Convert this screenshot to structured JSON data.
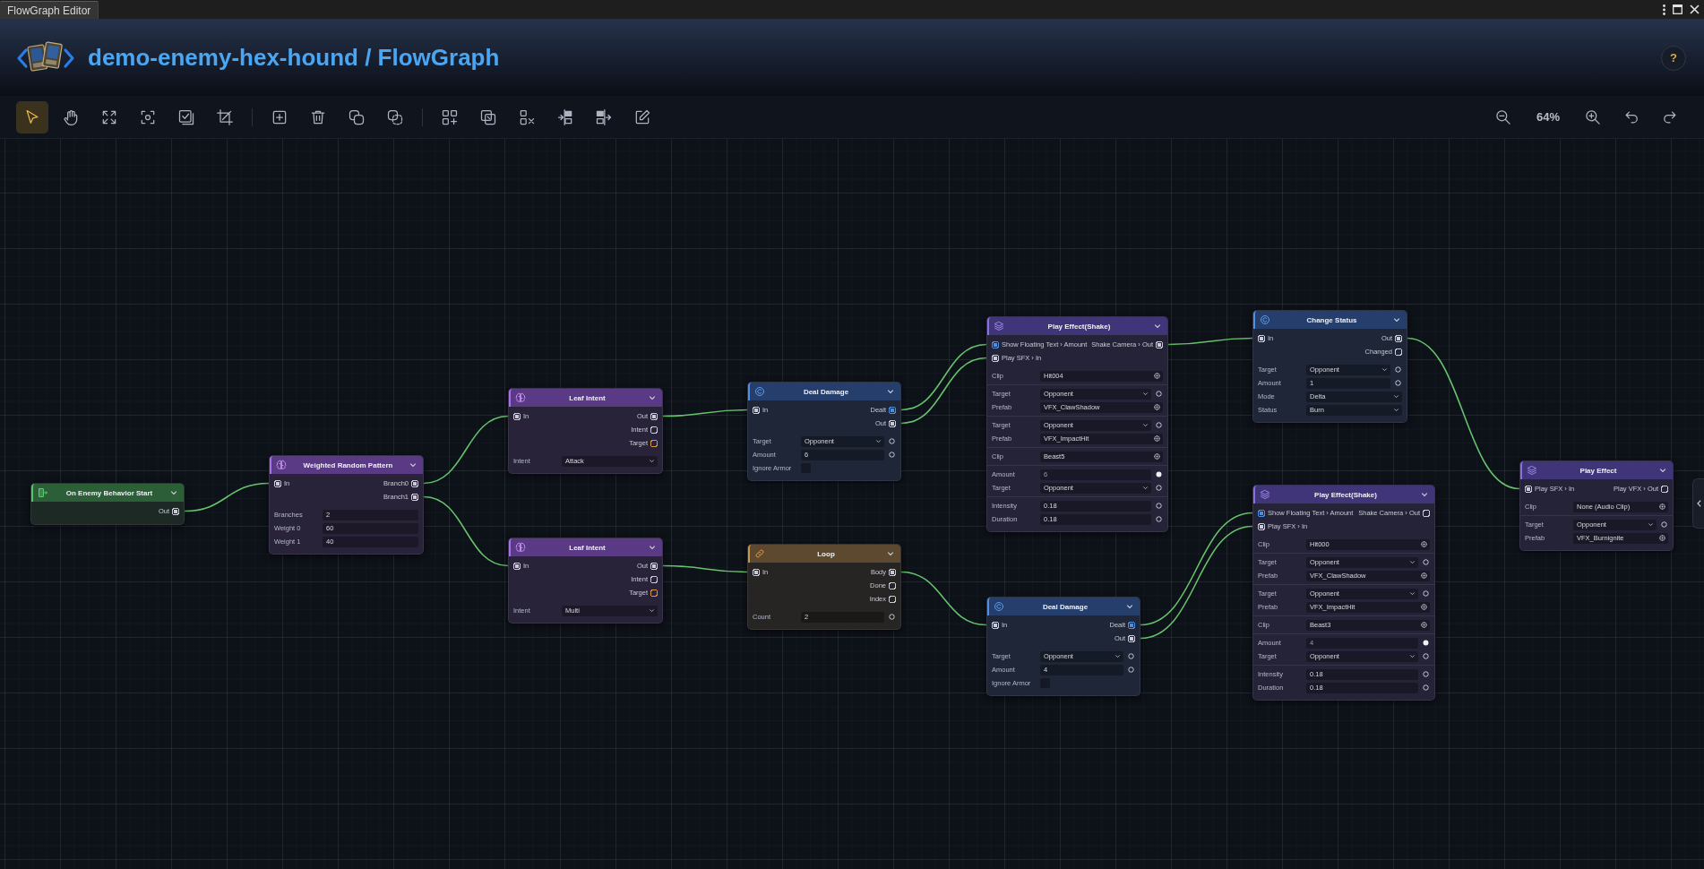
{
  "window": {
    "tab": "FlowGraph Editor"
  },
  "header": {
    "title": "demo-enemy-hex-hound / FlowGraph",
    "help": "?"
  },
  "toolbar": {
    "tool_groups": [
      [
        {
          "selected": true
        },
        {
          "selected": false
        },
        {
          "selected": false
        },
        {
          "selected": false
        },
        {
          "selected": false
        },
        {
          "selected": false
        }
      ],
      [
        {
          "selected": false
        },
        {
          "selected": false
        },
        {
          "selected": false
        },
        {
          "selected": false
        }
      ],
      [
        {
          "selected": false
        },
        {
          "selected": false
        },
        {
          "selected": false
        },
        {
          "selected": false
        },
        {
          "selected": false
        },
        {
          "selected": false
        }
      ]
    ],
    "zoom": "64%"
  },
  "nodes": [
    {
      "kind": "event",
      "title": "On Enemy Behavior Start",
      "outputs": [
        {
          "label": "Out",
          "connected": true,
          "color": "#c9ccd8"
        }
      ]
    },
    {
      "kind": "intent",
      "title": "Weighted Random Pattern",
      "inputs": [
        {
          "label": "In",
          "connected": true,
          "color": "#c9ccd8"
        }
      ],
      "outputs": [
        {
          "label": "Branch0",
          "connected": true,
          "color": "#c9ccd8"
        },
        {
          "label": "Branch1",
          "connected": true,
          "color": "#c9ccd8"
        }
      ],
      "sections": [
        {
          "fields": [
            {
              "label": "Branches",
              "value": "2",
              "kind": "text"
            },
            {
              "label": "Weight 0",
              "value": "60",
              "kind": "text"
            },
            {
              "label": "Weight 1",
              "value": "40",
              "kind": "text"
            }
          ]
        }
      ]
    },
    {
      "kind": "intent",
      "title": "Leaf Intent",
      "inputs": [
        {
          "label": "In",
          "connected": true,
          "color": "#c9ccd8"
        }
      ],
      "outputs": [
        {
          "label": "Out",
          "connected": true,
          "color": "#c9ccd8"
        },
        {
          "label": "Intent",
          "connected": false,
          "color": "#c9ccd8"
        },
        {
          "label": "Target",
          "connected": false,
          "color": "#e0923a"
        }
      ],
      "sections": [
        {
          "fields": [
            {
              "label": "Intent",
              "value": "Attack",
              "kind": "dropdown"
            }
          ]
        }
      ]
    },
    {
      "kind": "intent",
      "title": "Leaf Intent",
      "inputs": [
        {
          "label": "In",
          "connected": true,
          "color": "#c9ccd8"
        }
      ],
      "outputs": [
        {
          "label": "Out",
          "connected": true,
          "color": "#c9ccd8"
        },
        {
          "label": "Intent",
          "connected": false,
          "color": "#c9ccd8"
        },
        {
          "label": "Target",
          "connected": false,
          "color": "#e0923a"
        }
      ],
      "sections": [
        {
          "fields": [
            {
              "label": "Intent",
              "value": "Multi",
              "kind": "dropdown"
            }
          ]
        }
      ]
    },
    {
      "kind": "action",
      "title": "Deal Damage",
      "inputs": [
        {
          "label": "In",
          "connected": true,
          "color": "#c9ccd8"
        }
      ],
      "outputs": [
        {
          "label": "Dealt",
          "connected": true,
          "color": "#4a90e2"
        },
        {
          "label": "Out",
          "connected": true,
          "color": "#c9ccd8"
        }
      ],
      "sections": [
        {
          "fields": [
            {
              "label": "Target",
              "value": "Opponent",
              "kind": "dropdown",
              "port": {
                "connected": false
              }
            },
            {
              "label": "Amount",
              "value": "6",
              "kind": "text",
              "port": {
                "connected": false
              }
            },
            {
              "label": "Ignore Armor",
              "kind": "checkbox",
              "checked": false
            }
          ]
        }
      ]
    },
    {
      "kind": "loop",
      "title": "Loop",
      "inputs": [
        {
          "label": "In",
          "connected": true,
          "color": "#c9ccd8"
        }
      ],
      "outputs": [
        {
          "label": "Body",
          "connected": true,
          "color": "#c9ccd8"
        },
        {
          "label": "Done",
          "connected": false,
          "color": "#c9ccd8"
        },
        {
          "label": "Index",
          "connected": false,
          "color": "#c9ccd8"
        }
      ],
      "sections": [
        {
          "fields": [
            {
              "label": "Count",
              "value": "2",
              "kind": "text",
              "port": {
                "connected": false
              }
            }
          ]
        }
      ]
    },
    {
      "kind": "effect",
      "title": "Play Effect(Shake)",
      "inputs": [
        {
          "label": "Show Floating Text › Amount",
          "connected": true,
          "color": "#4a90e2"
        },
        {
          "label": "Play SFX › In",
          "connected": true,
          "color": "#c9ccd8"
        }
      ],
      "outputs": [
        {
          "label": "Shake Camera › Out",
          "connected": true,
          "color": "#c9ccd8"
        }
      ],
      "sections": [
        {
          "fields": [
            {
              "label": "Clip",
              "value": "Hit004",
              "kind": "object"
            }
          ]
        },
        {
          "fields": [
            {
              "label": "Target",
              "value": "Opponent",
              "kind": "dropdown",
              "port": {
                "connected": false
              }
            },
            {
              "label": "Prefab",
              "value": "VFX_ClawShadow",
              "kind": "object"
            }
          ]
        },
        {
          "fields": [
            {
              "label": "Target",
              "value": "Opponent",
              "kind": "dropdown",
              "port": {
                "connected": false
              }
            },
            {
              "label": "Prefab",
              "value": "VFX_ImpactHit",
              "kind": "object"
            }
          ]
        },
        {
          "fields": [
            {
              "label": "Clip",
              "value": "Beast5",
              "kind": "object"
            }
          ]
        },
        {
          "fields": [
            {
              "label": "Amount",
              "value": "6",
              "kind": "text",
              "port": {
                "connected": true
              }
            },
            {
              "label": "Target",
              "value": "Opponent",
              "kind": "dropdown",
              "port": {
                "connected": false
              }
            }
          ]
        },
        {
          "fields": [
            {
              "label": "Intensity",
              "value": "0.18",
              "kind": "text",
              "port": {
                "connected": false
              }
            },
            {
              "label": "Duration",
              "value": "0.18",
              "kind": "text",
              "port": {
                "connected": false
              }
            }
          ]
        }
      ]
    },
    {
      "kind": "action",
      "title": "Deal Damage",
      "inputs": [
        {
          "label": "In",
          "connected": true,
          "color": "#c9ccd8"
        }
      ],
      "outputs": [
        {
          "label": "Dealt",
          "connected": true,
          "color": "#4a90e2"
        },
        {
          "label": "Out",
          "connected": true,
          "color": "#c9ccd8"
        }
      ],
      "sections": [
        {
          "fields": [
            {
              "label": "Target",
              "value": "Opponent",
              "kind": "dropdown",
              "port": {
                "connected": false
              }
            },
            {
              "label": "Amount",
              "value": "4",
              "kind": "text",
              "port": {
                "connected": false
              }
            },
            {
              "label": "Ignore Armor",
              "kind": "checkbox",
              "checked": false
            }
          ]
        }
      ]
    },
    {
      "kind": "action",
      "title": "Change Status",
      "inputs": [
        {
          "label": "In",
          "connected": true,
          "color": "#c9ccd8"
        }
      ],
      "outputs": [
        {
          "label": "Out",
          "connected": true,
          "color": "#c9ccd8"
        },
        {
          "label": "Changed",
          "connected": false,
          "color": "#c9ccd8"
        }
      ],
      "sections": [
        {
          "fields": [
            {
              "label": "Target",
              "value": "Opponent",
              "kind": "dropdown",
              "port": {
                "connected": false
              }
            },
            {
              "label": "Amount",
              "value": "1",
              "kind": "text",
              "port": {
                "connected": false
              }
            },
            {
              "label": "Mode",
              "value": "Delta",
              "kind": "dropdown"
            },
            {
              "label": "Status",
              "value": "Burn",
              "kind": "dropdown"
            }
          ]
        }
      ]
    },
    {
      "kind": "effect",
      "title": "Play Effect(Shake)",
      "inputs": [
        {
          "label": "Show Floating Text › Amount",
          "connected": true,
          "color": "#4a90e2"
        },
        {
          "label": "Play SFX › In",
          "connected": true,
          "color": "#c9ccd8"
        }
      ],
      "outputs": [
        {
          "label": "Shake Camera › Out",
          "connected": false,
          "color": "#c9ccd8"
        }
      ],
      "sections": [
        {
          "fields": [
            {
              "label": "Clip",
              "value": "Hit000",
              "kind": "object"
            }
          ]
        },
        {
          "fields": [
            {
              "label": "Target",
              "value": "Opponent",
              "kind": "dropdown",
              "port": {
                "connected": false
              }
            },
            {
              "label": "Prefab",
              "value": "VFX_ClawShadow",
              "kind": "object"
            }
          ]
        },
        {
          "fields": [
            {
              "label": "Target",
              "value": "Opponent",
              "kind": "dropdown",
              "port": {
                "connected": false
              }
            },
            {
              "label": "Prefab",
              "value": "VFX_ImpactHit",
              "kind": "object"
            }
          ]
        },
        {
          "fields": [
            {
              "label": "Clip",
              "value": "Beast3",
              "kind": "object"
            }
          ]
        },
        {
          "fields": [
            {
              "label": "Amount",
              "value": "4",
              "kind": "text",
              "port": {
                "connected": true
              }
            },
            {
              "label": "Target",
              "value": "Opponent",
              "kind": "dropdown",
              "port": {
                "connected": false
              }
            }
          ]
        },
        {
          "fields": [
            {
              "label": "Intensity",
              "value": "0.18",
              "kind": "text",
              "port": {
                "connected": false
              }
            },
            {
              "label": "Duration",
              "value": "0.18",
              "kind": "text",
              "port": {
                "connected": false
              }
            }
          ]
        }
      ]
    },
    {
      "kind": "effect",
      "title": "Play Effect",
      "inputs": [
        {
          "label": "Play SFX › In",
          "connected": true,
          "color": "#c9ccd8"
        }
      ],
      "outputs": [
        {
          "label": "Play VFX › Out",
          "connected": false,
          "color": "#c9ccd8"
        }
      ],
      "sections": [
        {
          "fields": [
            {
              "label": "Clip",
              "value": "None (Audio Clip)",
              "kind": "object"
            }
          ]
        },
        {
          "fields": [
            {
              "label": "Target",
              "value": "Opponent",
              "kind": "dropdown",
              "port": {
                "connected": false
              }
            },
            {
              "label": "Prefab",
              "value": "VFX_Burnignite",
              "kind": "object"
            }
          ]
        }
      ]
    }
  ]
}
